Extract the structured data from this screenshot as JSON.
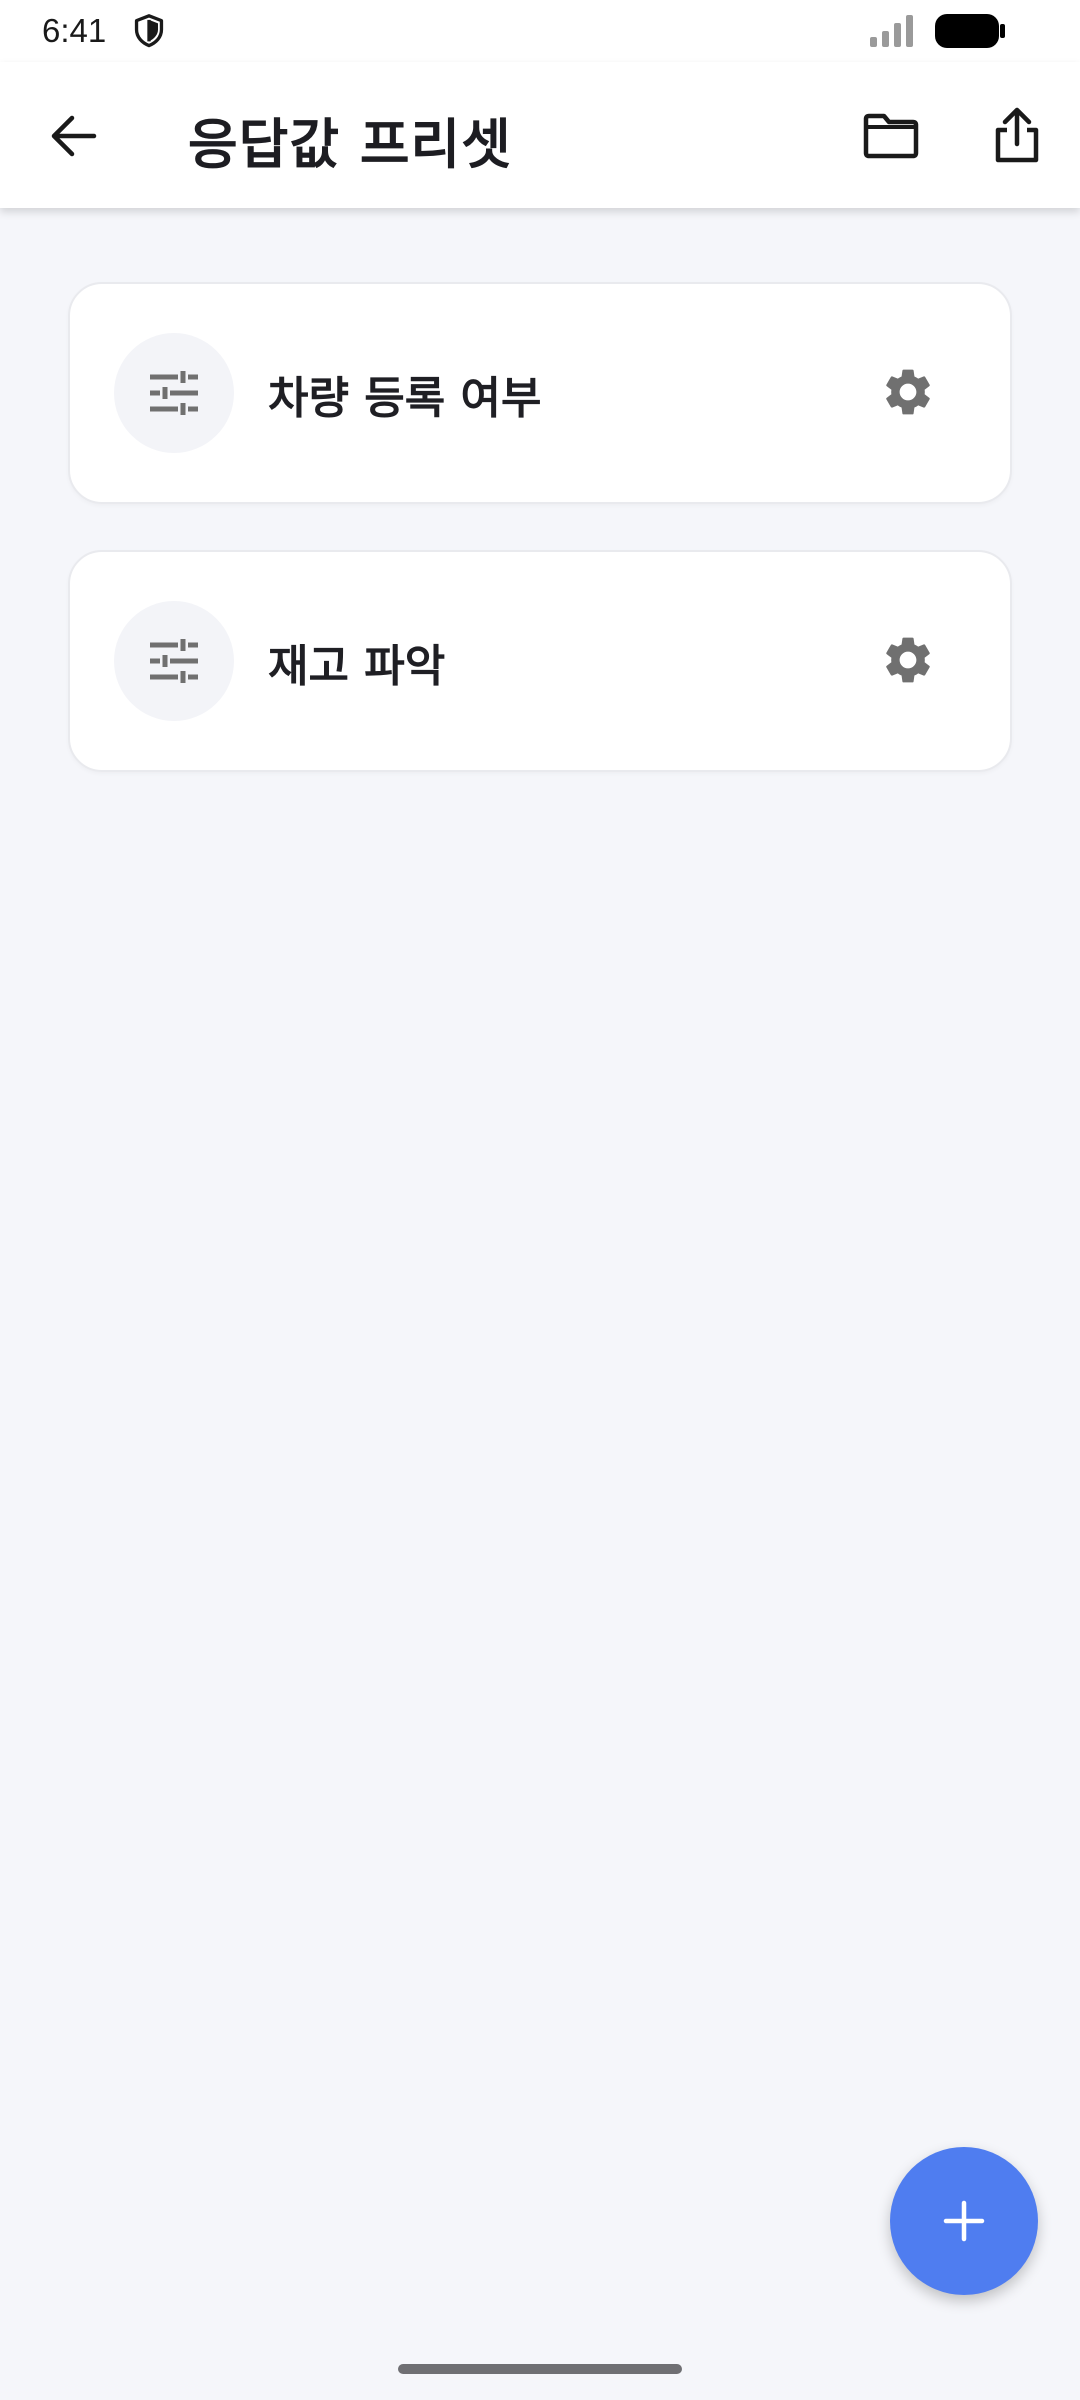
{
  "status_bar": {
    "time": "6:41"
  },
  "app_bar": {
    "title": "응답값 프리셋",
    "icons": [
      "back-arrow-icon",
      "folder-icon",
      "share-icon"
    ]
  },
  "presets": [
    {
      "label": "차량 등록 여부",
      "icon": "sliders-icon",
      "action_icon": "gear-icon"
    },
    {
      "label": "재고 파악",
      "icon": "sliders-icon",
      "action_icon": "gear-icon"
    }
  ],
  "fab": {
    "icon": "plus-icon"
  },
  "colors": {
    "accent": "#4f7df0",
    "background": "#f5f6fa",
    "card": "#ffffff",
    "icon_gray": "#707070"
  }
}
